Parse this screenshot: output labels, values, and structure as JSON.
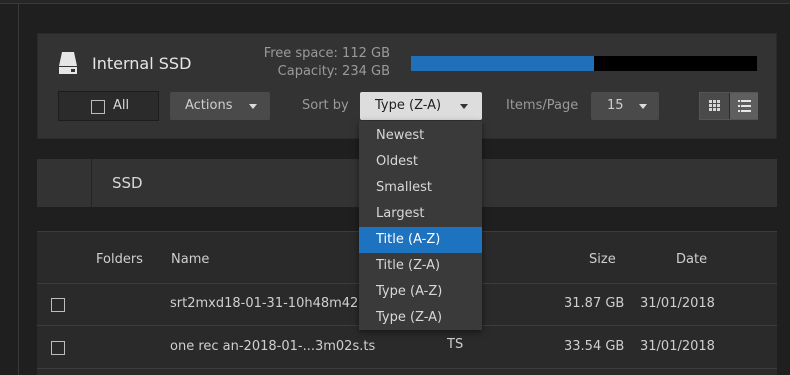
{
  "drive": {
    "name": "Internal SSD",
    "free_space": "Free space: 112 GB",
    "capacity": "Capacity: 234 GB",
    "used_fraction": 0.53
  },
  "toolbar": {
    "all_label": "All",
    "actions_label": "Actions",
    "sort_by_label": "Sort by",
    "sort_value": "Type (Z-A)",
    "items_per_page_label": "Items/Page",
    "items_per_page_value": "15"
  },
  "breadcrumb": {
    "folder": "SSD"
  },
  "table": {
    "headers": {
      "folders": "Folders",
      "name": "Name",
      "size": "Size",
      "date": "Date"
    },
    "rows": [
      {
        "name": "srt2mxd18-01-31-10h48m42",
        "type": "",
        "size": "31.87 GB",
        "date": "31/01/2018"
      },
      {
        "name": "one rec an-2018-01-...3m02s.ts",
        "type": "TS",
        "size": "33.54 GB",
        "date": "31/01/2018"
      }
    ]
  },
  "sort_menu": {
    "options": [
      "Newest",
      "Oldest",
      "Smallest",
      "Largest",
      "Title (A-Z)",
      "Title (Z-A)",
      "Type (A-Z)",
      "Type (Z-A)"
    ],
    "highlighted": "Title (A-Z)"
  },
  "colors": {
    "accent": "#1e73c0",
    "capacity_fill": "#1f6fba",
    "background": "#1f1f1f",
    "panel": "#333333"
  },
  "icons": {
    "drive": "drive-icon",
    "grid_view": "grid-view-icon",
    "list_view": "list-view-icon"
  }
}
